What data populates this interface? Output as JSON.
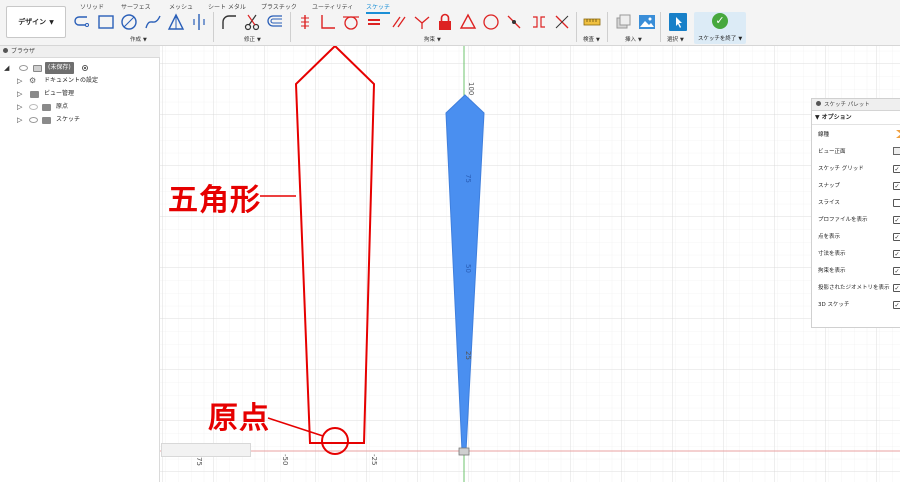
{
  "workspace": {
    "label": "デザイン"
  },
  "tabs": [
    {
      "label": "ソリッド"
    },
    {
      "label": "サーフェス"
    },
    {
      "label": "メッシュ"
    },
    {
      "label": "シート メタル"
    },
    {
      "label": "プラスチック"
    },
    {
      "label": "ユーティリティ"
    },
    {
      "label": "スケッチ",
      "active": true
    }
  ],
  "groups": {
    "create": "作成",
    "modify": "修正",
    "constraints": "拘束",
    "inspect": "検査",
    "insert": "挿入",
    "select": "選択",
    "finish": "スケッチを終了"
  },
  "browser": {
    "title": "ブラウザ",
    "document": "(未保存)",
    "items": [
      {
        "label": "ドキュメントの設定",
        "icon": "gear-icon"
      },
      {
        "label": "ビュー管理",
        "icon": "folder-icon"
      },
      {
        "label": "原点",
        "icon": "folder-icon"
      },
      {
        "label": "スケッチ",
        "icon": "folder-icon"
      }
    ]
  },
  "palette": {
    "title": "スケッチ パレット",
    "section": "オプション",
    "rows": [
      {
        "label": "線種",
        "control": "line-type-icon"
      },
      {
        "label": "ビュー正面",
        "control": "view-icon"
      },
      {
        "label": "スケッチ グリッド",
        "checked": true
      },
      {
        "label": "スナップ",
        "checked": true
      },
      {
        "label": "スライス",
        "checked": false
      },
      {
        "label": "プロファイルを表示",
        "checked": true
      },
      {
        "label": "点を表示",
        "checked": true
      },
      {
        "label": "寸法を表示",
        "checked": true
      },
      {
        "label": "拘束を表示",
        "checked": true
      },
      {
        "label": "投影されたジオメトリを表示",
        "checked": true
      },
      {
        "label": "3D スケッチ",
        "checked": true
      }
    ]
  },
  "annotations": {
    "pentagon": "五角形",
    "origin": "原点"
  },
  "axis_labels": {
    "x": [
      "75",
      "-50",
      "-25"
    ],
    "y": [
      "100",
      "75",
      "50",
      "25"
    ]
  },
  "colors": {
    "accent": "#1b8fd6",
    "annotation": "#e60000",
    "axis_green": "#6cc36c",
    "axis_red": "#e9a0a0",
    "blue_shape": "#4a8ff0"
  }
}
